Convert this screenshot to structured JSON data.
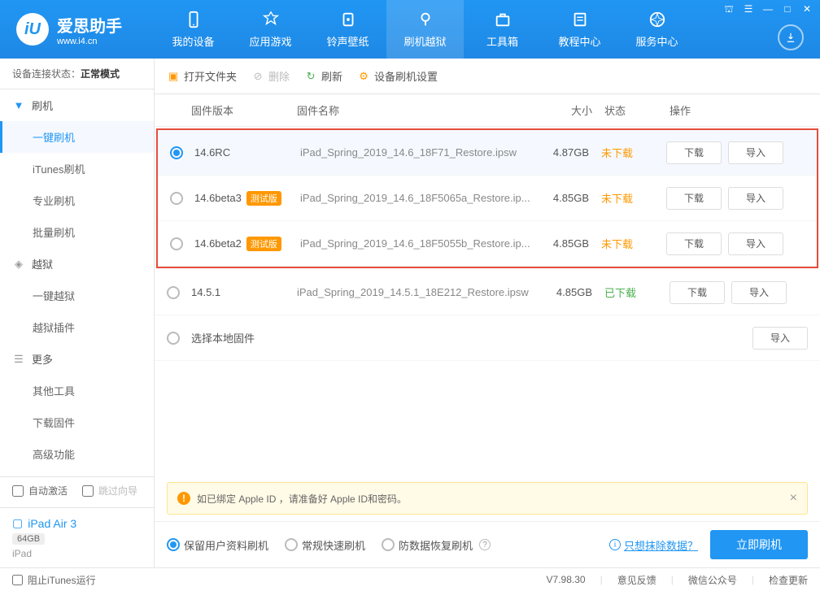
{
  "app": {
    "title": "爱思助手",
    "url": "www.i4.cn"
  },
  "winctrl": {
    "cart": "⛫",
    "menu": "☰",
    "min": "—",
    "max": "□",
    "close": "✕"
  },
  "nav": [
    {
      "label": "我的设备",
      "icon": "device"
    },
    {
      "label": "应用游戏",
      "icon": "apps"
    },
    {
      "label": "铃声壁纸",
      "icon": "music"
    },
    {
      "label": "刷机越狱",
      "icon": "flash",
      "active": true
    },
    {
      "label": "工具箱",
      "icon": "toolbox"
    },
    {
      "label": "教程中心",
      "icon": "tutorial"
    },
    {
      "label": "服务中心",
      "icon": "service"
    }
  ],
  "conn": {
    "label": "设备连接状态：",
    "value": "正常模式"
  },
  "sidebar": {
    "cats": [
      {
        "icon": "flash",
        "label": "刷机",
        "items": [
          {
            "label": "一键刷机",
            "active": true
          },
          {
            "label": "iTunes刷机"
          },
          {
            "label": "专业刷机"
          },
          {
            "label": "批量刷机"
          }
        ]
      },
      {
        "icon": "shield",
        "label": "越狱",
        "items": [
          {
            "label": "一键越狱"
          },
          {
            "label": "越狱插件"
          }
        ]
      },
      {
        "icon": "more",
        "label": "更多",
        "items": [
          {
            "label": "其他工具"
          },
          {
            "label": "下载固件"
          },
          {
            "label": "高级功能"
          }
        ]
      }
    ],
    "checks": [
      {
        "label": "自动激活",
        "checked": false
      },
      {
        "label": "跳过向导",
        "checked": false
      }
    ],
    "device": {
      "name": "iPad Air 3",
      "storage": "64GB",
      "type": "iPad"
    }
  },
  "toolbar": {
    "open": "打开文件夹",
    "delete": "删除",
    "refresh": "刷新",
    "settings": "设备刷机设置"
  },
  "table": {
    "head": {
      "ver": "固件版本",
      "name": "固件名称",
      "size": "大小",
      "status": "状态",
      "ops": "操作"
    },
    "rows": [
      {
        "selected": true,
        "ver": "14.6RC",
        "beta": false,
        "name": "iPad_Spring_2019_14.6_18F71_Restore.ipsw",
        "size": "4.87GB",
        "status": "未下载",
        "status_cls": "no",
        "hl": true
      },
      {
        "selected": false,
        "ver": "14.6beta3",
        "beta": true,
        "name": "iPad_Spring_2019_14.6_18F5065a_Restore.ip...",
        "size": "4.85GB",
        "status": "未下载",
        "status_cls": "no",
        "hl": true
      },
      {
        "selected": false,
        "ver": "14.6beta2",
        "beta": true,
        "name": "iPad_Spring_2019_14.6_18F5055b_Restore.ip...",
        "size": "4.85GB",
        "status": "未下载",
        "status_cls": "no",
        "hl": true
      },
      {
        "selected": false,
        "ver": "14.5.1",
        "beta": false,
        "name": "iPad_Spring_2019_14.5.1_18E212_Restore.ipsw",
        "size": "4.85GB",
        "status": "已下载",
        "status_cls": "ok",
        "hl": false
      },
      {
        "selected": false,
        "ver": "选择本地固件",
        "beta": false,
        "name": "",
        "size": "",
        "status": "",
        "status_cls": "",
        "hl": false,
        "local": true
      }
    ],
    "beta_tag": "测试版",
    "btn_dl": "下载",
    "btn_imp": "导入"
  },
  "banner": {
    "text": "如已绑定 Apple ID ，请准备好 Apple ID和密码。"
  },
  "flash": {
    "opts": [
      {
        "label": "保留用户资料刷机",
        "on": true
      },
      {
        "label": "常规快速刷机",
        "on": false
      },
      {
        "label": "防数据恢复刷机",
        "on": false,
        "q": true
      }
    ],
    "wipe": "只想抹除数据？",
    "btn": "立即刷机"
  },
  "statusbar": {
    "block": "阻止iTunes运行",
    "ver": "V7.98.30",
    "feedback": "意见反馈",
    "wechat": "微信公众号",
    "update": "检查更新"
  }
}
